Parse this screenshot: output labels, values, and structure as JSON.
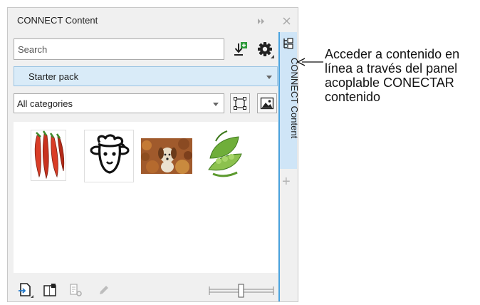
{
  "panel": {
    "title": "CONNECT Content",
    "search": {
      "placeholder": "Search",
      "value": ""
    },
    "pack_select": {
      "selected": "Starter pack"
    },
    "category_select": {
      "selected": "All categories"
    },
    "side_tab": {
      "label": "CONNECT Content"
    },
    "thumbnails": [
      {
        "name": "chili-peppers"
      },
      {
        "name": "sheep-icon"
      },
      {
        "name": "dog-in-leaves"
      },
      {
        "name": "green-peas"
      }
    ]
  },
  "annotation": {
    "text": "Acceder a contenido en línea a través del panel acoplable CONECTAR contenido"
  },
  "colors": {
    "accent": "#4aa3df",
    "selected_bg": "#d9ebf8",
    "panel_bg": "#f0f0f0"
  }
}
